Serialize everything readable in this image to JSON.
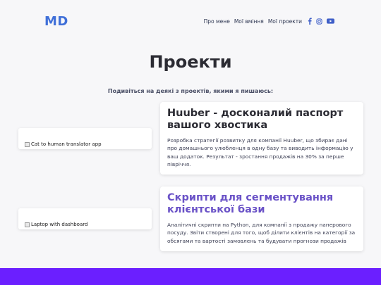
{
  "header": {
    "logo": "MD",
    "nav": [
      {
        "label": "Про мене"
      },
      {
        "label": "Мої вміння"
      },
      {
        "label": "Мої проекти"
      }
    ],
    "social_icons": [
      "facebook-icon",
      "instagram-icon",
      "youtube-icon"
    ]
  },
  "main": {
    "title": "Проекти",
    "subtitle": "Подивіться на деякі з проектів, якими я пишаюсь:",
    "projects": [
      {
        "image_alt": "Cat to human translator app",
        "title": "Huuber - досконалий паспорт вашого хвостика",
        "description": "Розробка стратегії розвитку для компанії Huuber, що збирає дані про домашнього улюбленця в одну базу та виводить інформацію у ваш додаток. Результат - зростання продажів на 30% за перше півріччя."
      },
      {
        "image_alt": "Laptop with dashboard",
        "title": "Скрипти для сегментування клієнтської бази",
        "description": "Аналітичні скрипти на Python, для компанії з продажу паперового посуду. Звіти створені для того, щоб ділити клієнтів на категорії за обсягами та вартості замовлень та будувати прогнози продажів"
      }
    ]
  },
  "colors": {
    "logo": "#3f6fd8",
    "accent_title": "#6a52c7",
    "footer_band": "#6b1fff",
    "social_icon": "#3f5fc8"
  }
}
